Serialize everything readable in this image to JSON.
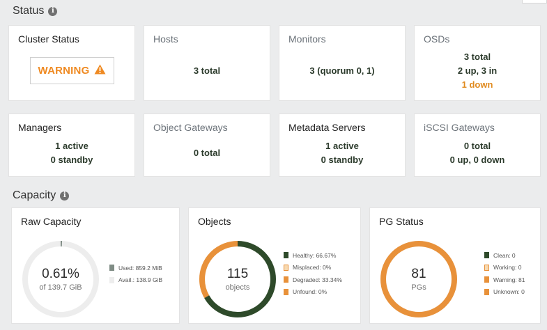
{
  "status_section": {
    "title": "Status"
  },
  "cards": {
    "cluster_status": {
      "title": "Cluster Status",
      "badge": "WARNING"
    },
    "hosts": {
      "title": "Hosts",
      "value": "3 total"
    },
    "monitors": {
      "title": "Monitors",
      "value": "3 (quorum 0, 1)"
    },
    "osds": {
      "title": "OSDs",
      "line1": "3 total",
      "line2": "2 up, 3 in",
      "line3": "1 down"
    },
    "managers": {
      "title": "Managers",
      "line1": "1 active",
      "line2": "0 standby"
    },
    "object_gateways": {
      "title": "Object Gateways",
      "value": "0 total"
    },
    "metadata_servers": {
      "title": "Metadata Servers",
      "line1": "1 active",
      "line2": "0 standby"
    },
    "iscsi_gateways": {
      "title": "iSCSI Gateways",
      "line1": "0 total",
      "line2": "0 up, 0 down"
    }
  },
  "capacity_section": {
    "title": "Capacity"
  },
  "raw_capacity": {
    "title": "Raw Capacity",
    "percent": "0.61%",
    "sub": "of 139.7 GiB",
    "used_fraction": 0.0061,
    "legend": [
      {
        "label": "Used: 859.2 MiB",
        "color": "#7f8c85"
      },
      {
        "label": "Avail.: 138.9 GiB",
        "color": "#ededed"
      }
    ]
  },
  "objects": {
    "title": "Objects",
    "count": "115",
    "sub": "objects",
    "segments": [
      {
        "fraction": 0.6667,
        "color": "#2e4a2a"
      },
      {
        "fraction": 0.3334,
        "color": "#e8913a"
      }
    ],
    "legend": [
      {
        "label": "Healthy: 66.67%",
        "color": "#2e4a2a"
      },
      {
        "label": "Misplaced: 0%",
        "color": "#f7d9b0"
      },
      {
        "label": "Degraded: 33.34%",
        "color": "#e8913a"
      },
      {
        "label": "Unfound: 0%",
        "color": "#e8913a"
      }
    ]
  },
  "pg_status": {
    "title": "PG Status",
    "count": "81",
    "sub": "PGs",
    "segments": [
      {
        "fraction": 1.0,
        "color": "#e8913a"
      }
    ],
    "legend": [
      {
        "label": "Clean: 0",
        "color": "#2e4a2a"
      },
      {
        "label": "Working: 0",
        "color": "#f7d9b0"
      },
      {
        "label": "Warning: 81",
        "color": "#e8913a"
      },
      {
        "label": "Unknown: 0",
        "color": "#e8913a"
      }
    ]
  }
}
